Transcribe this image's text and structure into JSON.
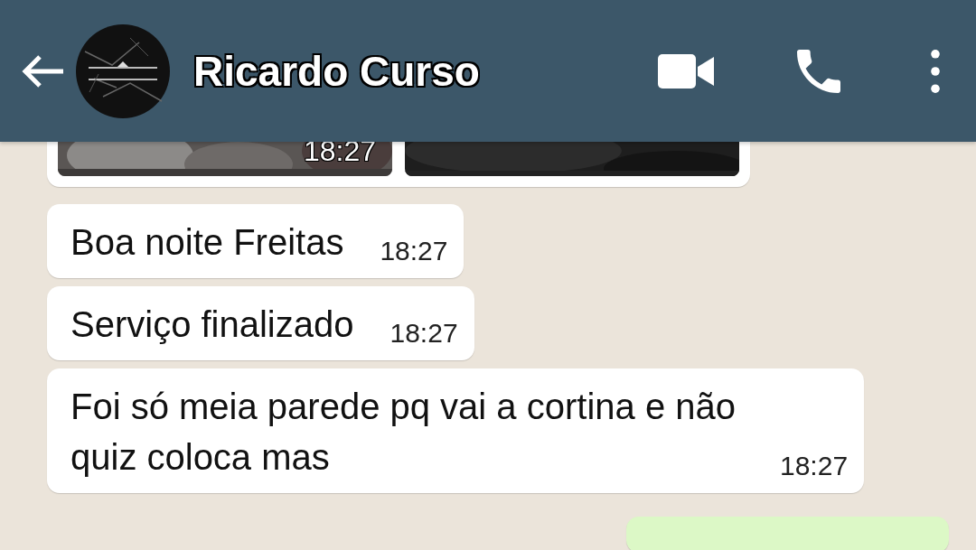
{
  "header": {
    "contact_name": "Ricardo Curso"
  },
  "messages": [
    {
      "kind": "media",
      "outgoing": false,
      "time": "18:27"
    },
    {
      "kind": "text",
      "outgoing": false,
      "text": "Boa noite Freitas",
      "time": "18:27"
    },
    {
      "kind": "text",
      "outgoing": false,
      "text": "Serviço finalizado",
      "time": "18:27"
    },
    {
      "kind": "text",
      "outgoing": false,
      "text": "Foi só meia parede pq vai a cortina e não quiz coloca mas",
      "time": "18:27"
    },
    {
      "kind": "partial",
      "outgoing": true
    }
  ]
}
